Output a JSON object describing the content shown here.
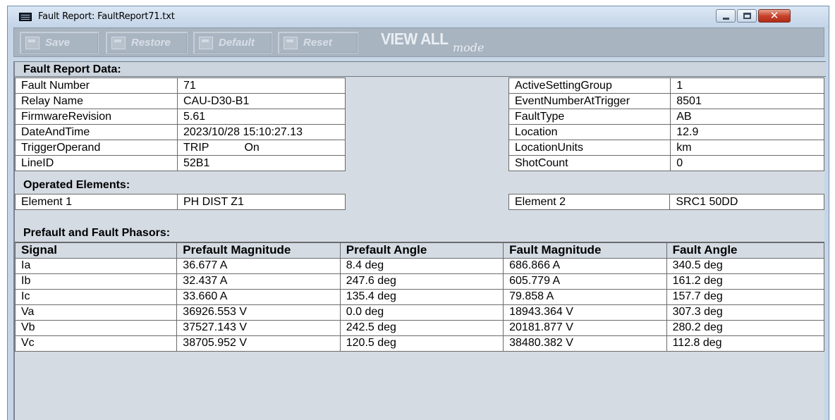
{
  "window": {
    "title": "Fault Report: FaultReport71.txt",
    "close_glyph": "✕"
  },
  "toolbar": {
    "save_label": "Save",
    "restore_label": "Restore",
    "default_label": "Default",
    "reset_label": "Reset",
    "view_all": "VIEW ALL",
    "mode": "mode"
  },
  "fault_report": {
    "title": "Fault Report Data:",
    "left": [
      {
        "label": "Fault Number",
        "value": "71"
      },
      {
        "label": "Relay Name",
        "value": "CAU-D30-B1"
      },
      {
        "label": "FirmwareRevision",
        "value": "5.61"
      },
      {
        "label": "DateAndTime",
        "value": "2023/10/28 15:10:27.13"
      },
      {
        "label": "TriggerOperand",
        "value": "TRIP",
        "value2": "On"
      },
      {
        "label": "LineID",
        "value": "52B1"
      }
    ],
    "right": [
      {
        "label": "ActiveSettingGroup",
        "value": "1"
      },
      {
        "label": "EventNumberAtTrigger",
        "value": "8501"
      },
      {
        "label": "FaultType",
        "value": "AB"
      },
      {
        "label": "Location",
        "value": "12.9"
      },
      {
        "label": "LocationUnits",
        "value": "km"
      },
      {
        "label": "ShotCount",
        "value": "0"
      }
    ]
  },
  "operated_elements": {
    "title": "Operated Elements:",
    "element1_label": "Element 1",
    "element1_value": "PH DIST Z1",
    "element2_label": "Element 2",
    "element2_value": "SRC1 50DD"
  },
  "phasors": {
    "title": "Prefault and Fault Phasors:",
    "headers": [
      "Signal",
      "Prefault Magnitude",
      "Prefault Angle",
      "Fault Magnitude",
      "Fault Angle"
    ],
    "rows": [
      [
        "Ia",
        "36.677 A",
        "8.4 deg",
        "686.866 A",
        "340.5 deg"
      ],
      [
        "Ib",
        "32.437 A",
        "247.6 deg",
        "605.779 A",
        "161.2 deg"
      ],
      [
        "Ic",
        "33.660 A",
        "135.4 deg",
        "79.858 A",
        "157.7 deg"
      ],
      [
        "Va",
        "36926.553 V",
        "0.0 deg",
        "18943.364 V",
        "307.3 deg"
      ],
      [
        "Vb",
        "37527.143 V",
        "242.5 deg",
        "20181.877 V",
        "280.2 deg"
      ],
      [
        "Vc",
        "38705.952 V",
        "120.5 deg",
        "38480.382 V",
        "112.8 deg"
      ]
    ]
  }
}
